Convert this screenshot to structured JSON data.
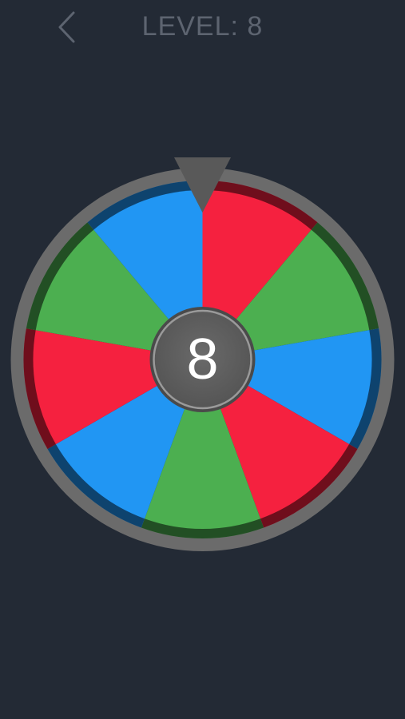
{
  "header": {
    "back_icon": "chevron-left-icon",
    "level_label": "LEVEL: 8"
  },
  "wheel": {
    "center_count": "8",
    "segments_clockwise_from_top": [
      "red",
      "green",
      "blue",
      "red",
      "green",
      "blue",
      "red",
      "green",
      "blue"
    ],
    "segment_colors": {
      "red": "#f5213f",
      "green": "#4caf50",
      "blue": "#2196f3"
    },
    "rim_color": "#6b6b6b",
    "hub_color": "#5f5f5f",
    "pointer_color": "#595959",
    "pointer_icon": "triangle-down-icon"
  }
}
